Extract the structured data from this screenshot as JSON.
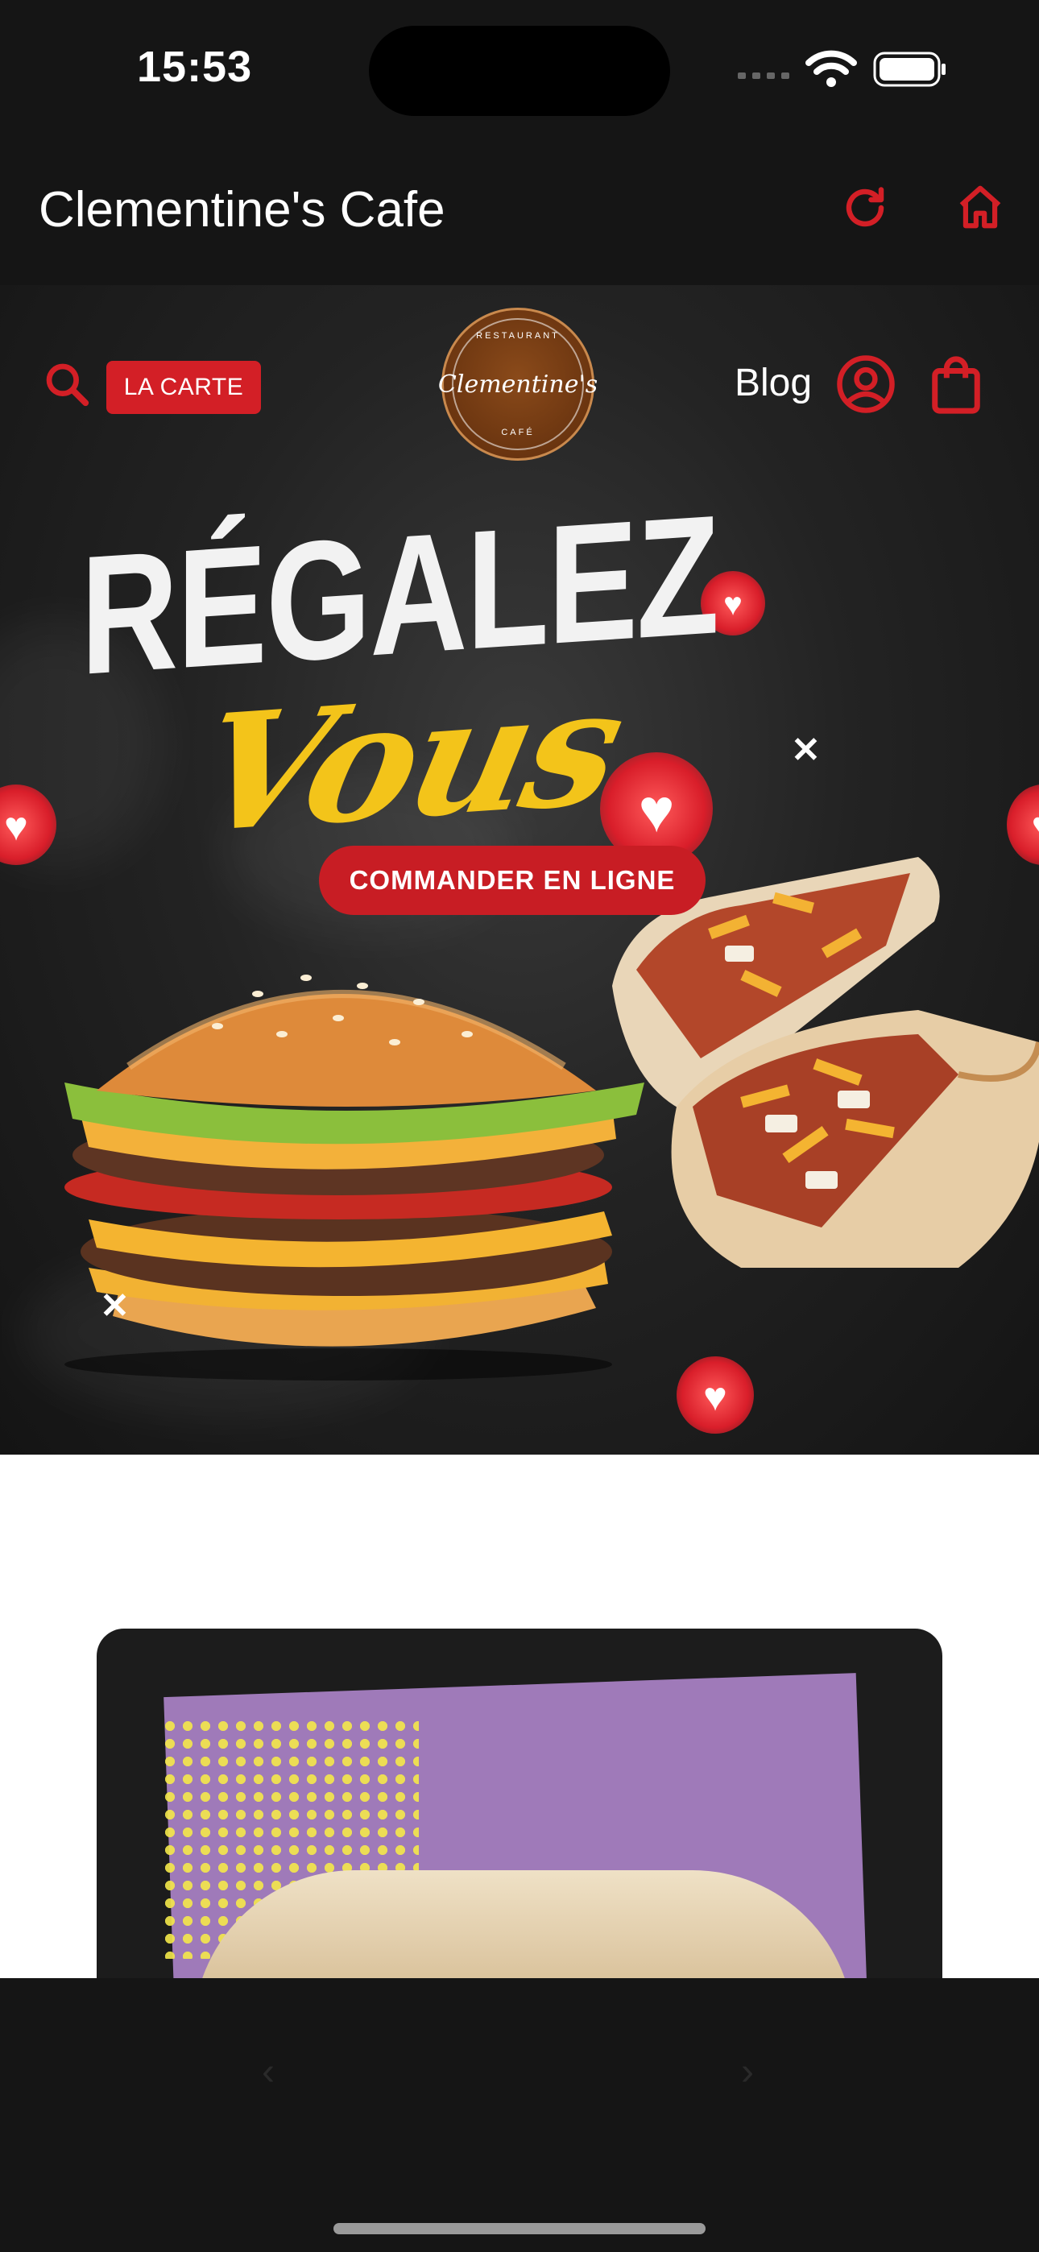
{
  "status_bar": {
    "time": "15:53"
  },
  "app_bar": {
    "title": "Clementine's Cafe",
    "refresh_icon": "refresh-icon",
    "home_icon": "home-icon"
  },
  "site_header": {
    "la_carte_label": "LA CARTE",
    "logo": {
      "top_text": "RESTAURANT",
      "name": "Clementine's",
      "bottom_text": "CAFÉ"
    },
    "blog_label": "Blog",
    "accent_color": "#d31f26"
  },
  "hero": {
    "headline_line1": "RÉGALEZ",
    "headline_line2": "Vous",
    "order_button_label": "COMMANDER EN LIGNE"
  },
  "bottom_nav": {
    "back_icon": "chevron-left-icon",
    "forward_icon": "chevron-right-icon"
  }
}
